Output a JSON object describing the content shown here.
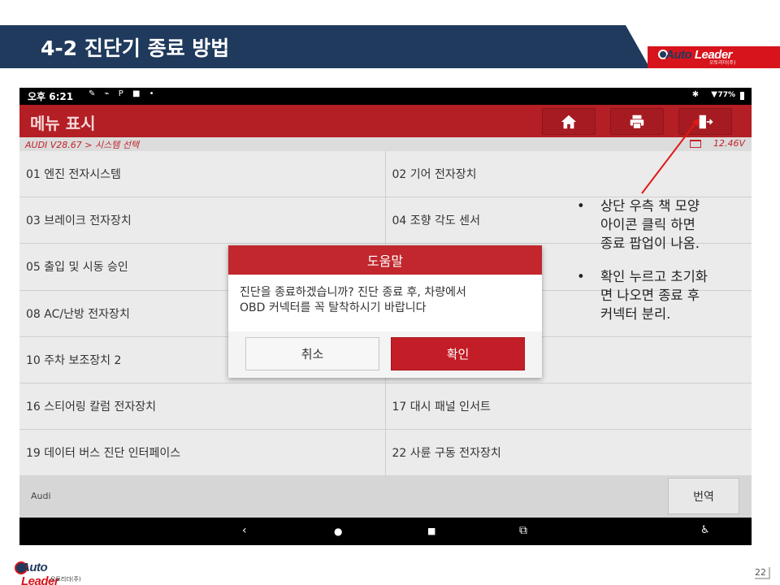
{
  "slide": {
    "title": "4-2 진단기 종료 방법",
    "page_number": "22"
  },
  "brand": {
    "logo_text_a": "Auto",
    "logo_text_b": "Leader",
    "logo_sub": "오토리더(주)",
    "accent_red": "#d7141c",
    "navy": "#1f3a5c"
  },
  "statusbar": {
    "time": "오후 6:21",
    "left_icons": "✎ ⌁ P ■ •",
    "right_icons": "✱ ▼",
    "battery": "77%"
  },
  "appbar": {
    "title": "메뉴 표시",
    "home_icon": "home-icon",
    "print_icon": "printer-icon",
    "exit_icon": "exit-door-icon"
  },
  "breadcrumb": {
    "path": "AUDI V28.67 > 시스템 선택",
    "voltage": "12.46V"
  },
  "systems": [
    {
      "left": "01 엔진 전자시스템",
      "right": "02 기어 전자장치"
    },
    {
      "left": "03 브레이크 전자장치",
      "right": "04 조향 각도 센서"
    },
    {
      "left": "05 출입 및 시동 승인",
      "right": ""
    },
    {
      "left": "08 AC/난방 전자장치",
      "right": ""
    },
    {
      "left": "10 주차 보조장치 2",
      "right": ""
    },
    {
      "left": "16 스티어링 칼럼 전자장치",
      "right": "17 대시 패널 인서트"
    },
    {
      "left": "19 데이터 버스 진단 인터페이스",
      "right": "22 사륜 구동 전자장치"
    }
  ],
  "footer": {
    "make": "Audi",
    "translate_label": "번역"
  },
  "navbar": {
    "back": "‹",
    "home": "●",
    "recents": "■",
    "screenshot": "⧉",
    "accessibility": "♿"
  },
  "dialog": {
    "title": "도움말",
    "message_line1": "진단을 종료하겠습니까? 진단 종료 후, 차량에서",
    "message_line2": "OBD 커넥터를 꼭 탈착하시기 바랍니다",
    "cancel_label": "취소",
    "ok_label": "확인"
  },
  "callout": {
    "bullet": "•",
    "item1_line1": "상단 우측 책 모양",
    "item1_line2": "아이콘 클릭 하면",
    "item1_line3": "종료 팝업이 나옴.",
    "item2_line1": "확인 누르고 초기화",
    "item2_line2": "면 나오면 종료 후",
    "item2_line3": "커넥터 분리."
  }
}
